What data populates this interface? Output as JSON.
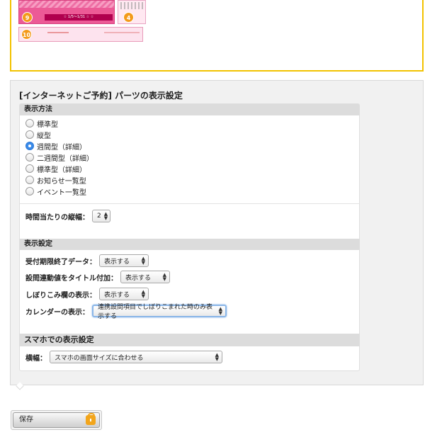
{
  "preview": {
    "badges": [
      "9",
      "4",
      "10"
    ],
    "banner_text": "☆ 1/5〜1/31 ☆ ☆"
  },
  "settings": {
    "title": "[インターネットご予約] パーツの表示設定",
    "display_method": {
      "heading": "表示方法",
      "options": [
        "標準型",
        "縦型",
        "週間型（詳細）",
        "二週間型（詳細）",
        "標準型（詳細）",
        "お知らせ一覧型",
        "イベント一覧型"
      ],
      "selected": "週間型（詳細）"
    },
    "row_height": {
      "label": "時間当たりの縦幅：",
      "value": "2"
    },
    "display_settings": {
      "heading": "表示設定",
      "fields": [
        {
          "label": "受付期限終了データ：",
          "value": "表示する"
        },
        {
          "label": "設問連動値をタイトル付加：",
          "value": "表示する"
        },
        {
          "label": "しぼりこみ欄の表示：",
          "value": "表示する"
        },
        {
          "label": "カレンダーの表示：",
          "value": "連携設問項目でしぼりこまれた時のみ表示する"
        }
      ]
    },
    "smartphone": {
      "heading": "スマホでの表示設定",
      "width_label": "横幅：",
      "width_value": "スマホの画面サイズに合わせる"
    }
  },
  "save": {
    "label": "保存",
    "icon": "lock-icon",
    "icon_color": "#f2a51b"
  },
  "colors": {
    "accent": "#f2c200",
    "selected_radio": "#3a8ae8",
    "pink": "#ec5a96"
  }
}
